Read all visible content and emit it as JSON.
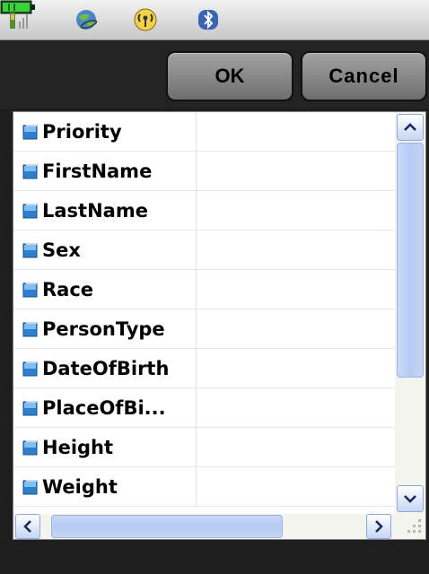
{
  "status_bar": {
    "icons": [
      "signal-icon",
      "globe-icon",
      "radio-icon",
      "bluetooth-icon",
      "battery-icon"
    ]
  },
  "toolbar": {
    "ok_label": "OK",
    "cancel_label": "Cancel"
  },
  "list": {
    "items": [
      {
        "label": "Priority",
        "value": ""
      },
      {
        "label": "FirstName",
        "value": ""
      },
      {
        "label": "LastName",
        "value": ""
      },
      {
        "label": "Sex",
        "value": ""
      },
      {
        "label": "Race",
        "value": ""
      },
      {
        "label": "PersonType",
        "value": ""
      },
      {
        "label": "DateOfBirth",
        "value": ""
      },
      {
        "label": "PlaceOfBi...",
        "value": ""
      },
      {
        "label": "Height",
        "value": ""
      },
      {
        "label": "Weight",
        "value": ""
      }
    ]
  },
  "colors": {
    "background": "#1e1e1e",
    "button": "#8a8a8a",
    "scrollbar_accent": "#b6cbf3",
    "row_icon": "#3a8fd8"
  }
}
